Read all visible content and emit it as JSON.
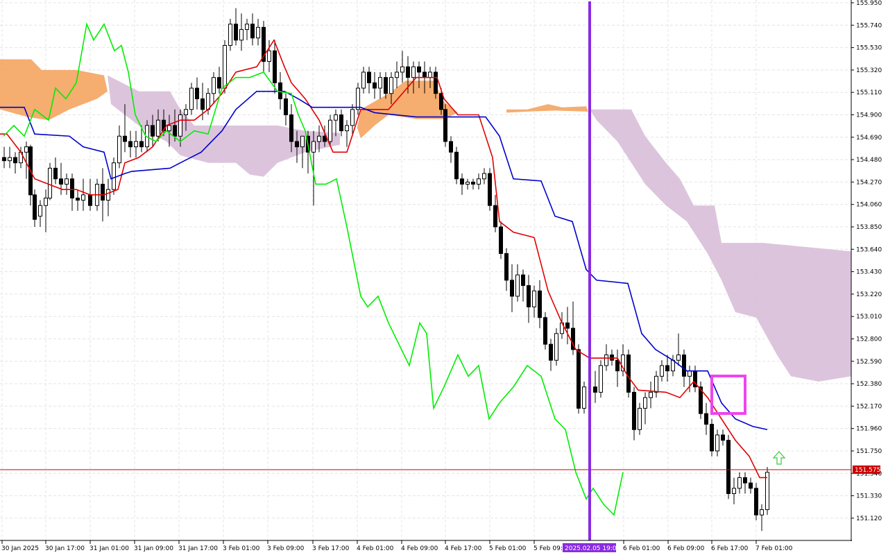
{
  "chart_data": {
    "type": "candlestick",
    "y_ticks": [
      "155.950",
      "155.740",
      "155.530",
      "155.320",
      "155.110",
      "154.900",
      "154.690",
      "154.480",
      "154.270",
      "154.060",
      "153.850",
      "153.640",
      "153.430",
      "153.220",
      "153.010",
      "152.800",
      "152.590",
      "152.380",
      "152.170",
      "151.960",
      "151.750",
      "151.540",
      "151.330",
      "151.120"
    ],
    "x_ticks": [
      "30 Jan 2025",
      "30 Jan 17:00",
      "31 Jan 01:00",
      "31 Jan 09:00",
      "31 Jan 17:00",
      "3 Feb 01:00",
      "3 Feb 09:00",
      "3 Feb 17:00",
      "4 Feb 01:00",
      "4 Feb 09:00",
      "4 Feb 17:00",
      "5 Feb 01:00",
      "5 Feb 09:00",
      "6 Feb 01:00",
      "6 Feb 09:00",
      "6 Feb 17:00",
      "7 Feb 01:00"
    ],
    "ylim": [
      151.0,
      155.95
    ],
    "grid": true,
    "current_price": "151.575",
    "current_price_value": 151.575,
    "crosshair_time": "2025.02.05 19:00",
    "colors": {
      "tenkan": "#e00000",
      "kijun": "#0000cc",
      "chikou": "#00ee00",
      "kumo_bull": "#f4a460",
      "kumo_bear": "#d8bfd8",
      "crosshair": "#8a2be2",
      "highlight_box": "#ee44ee",
      "price_line": "#cc0000",
      "arrow": "#33cc33"
    }
  }
}
